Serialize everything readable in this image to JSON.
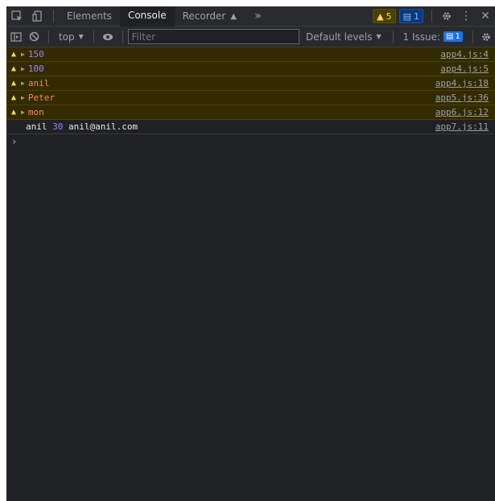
{
  "tabs": {
    "elements": "Elements",
    "console": "Console",
    "recorder": "Recorder",
    "more": "»"
  },
  "badges": {
    "warnings": "5",
    "messages": "1"
  },
  "toolbar": {
    "context": "top",
    "filter_placeholder": "Filter",
    "levels": "Default levels",
    "issues_label": "1 Issue:",
    "issues_count": "1"
  },
  "messages": [
    {
      "type": "warn",
      "value": "150",
      "kind": "num",
      "source": "app4.js:4"
    },
    {
      "type": "warn",
      "value": "100",
      "kind": "num",
      "source": "app4.js:5"
    },
    {
      "type": "warn",
      "value": "anil",
      "kind": "str",
      "source": "app4.js:18"
    },
    {
      "type": "warn",
      "value": "Peter",
      "kind": "str",
      "source": "app5.js:36"
    },
    {
      "type": "warn",
      "value": "mon",
      "kind": "str",
      "source": "app6.js:12"
    }
  ],
  "log": {
    "name": "anil",
    "age": "30",
    "email": "anil@anil.com",
    "source": "app7.js:11"
  },
  "prompt": "›",
  "colors": {
    "warn_bg": "#332b00",
    "warn_text": "#ffd35a",
    "number": "#9980ff",
    "string": "#f28b54",
    "panel_bg": "#202124"
  }
}
